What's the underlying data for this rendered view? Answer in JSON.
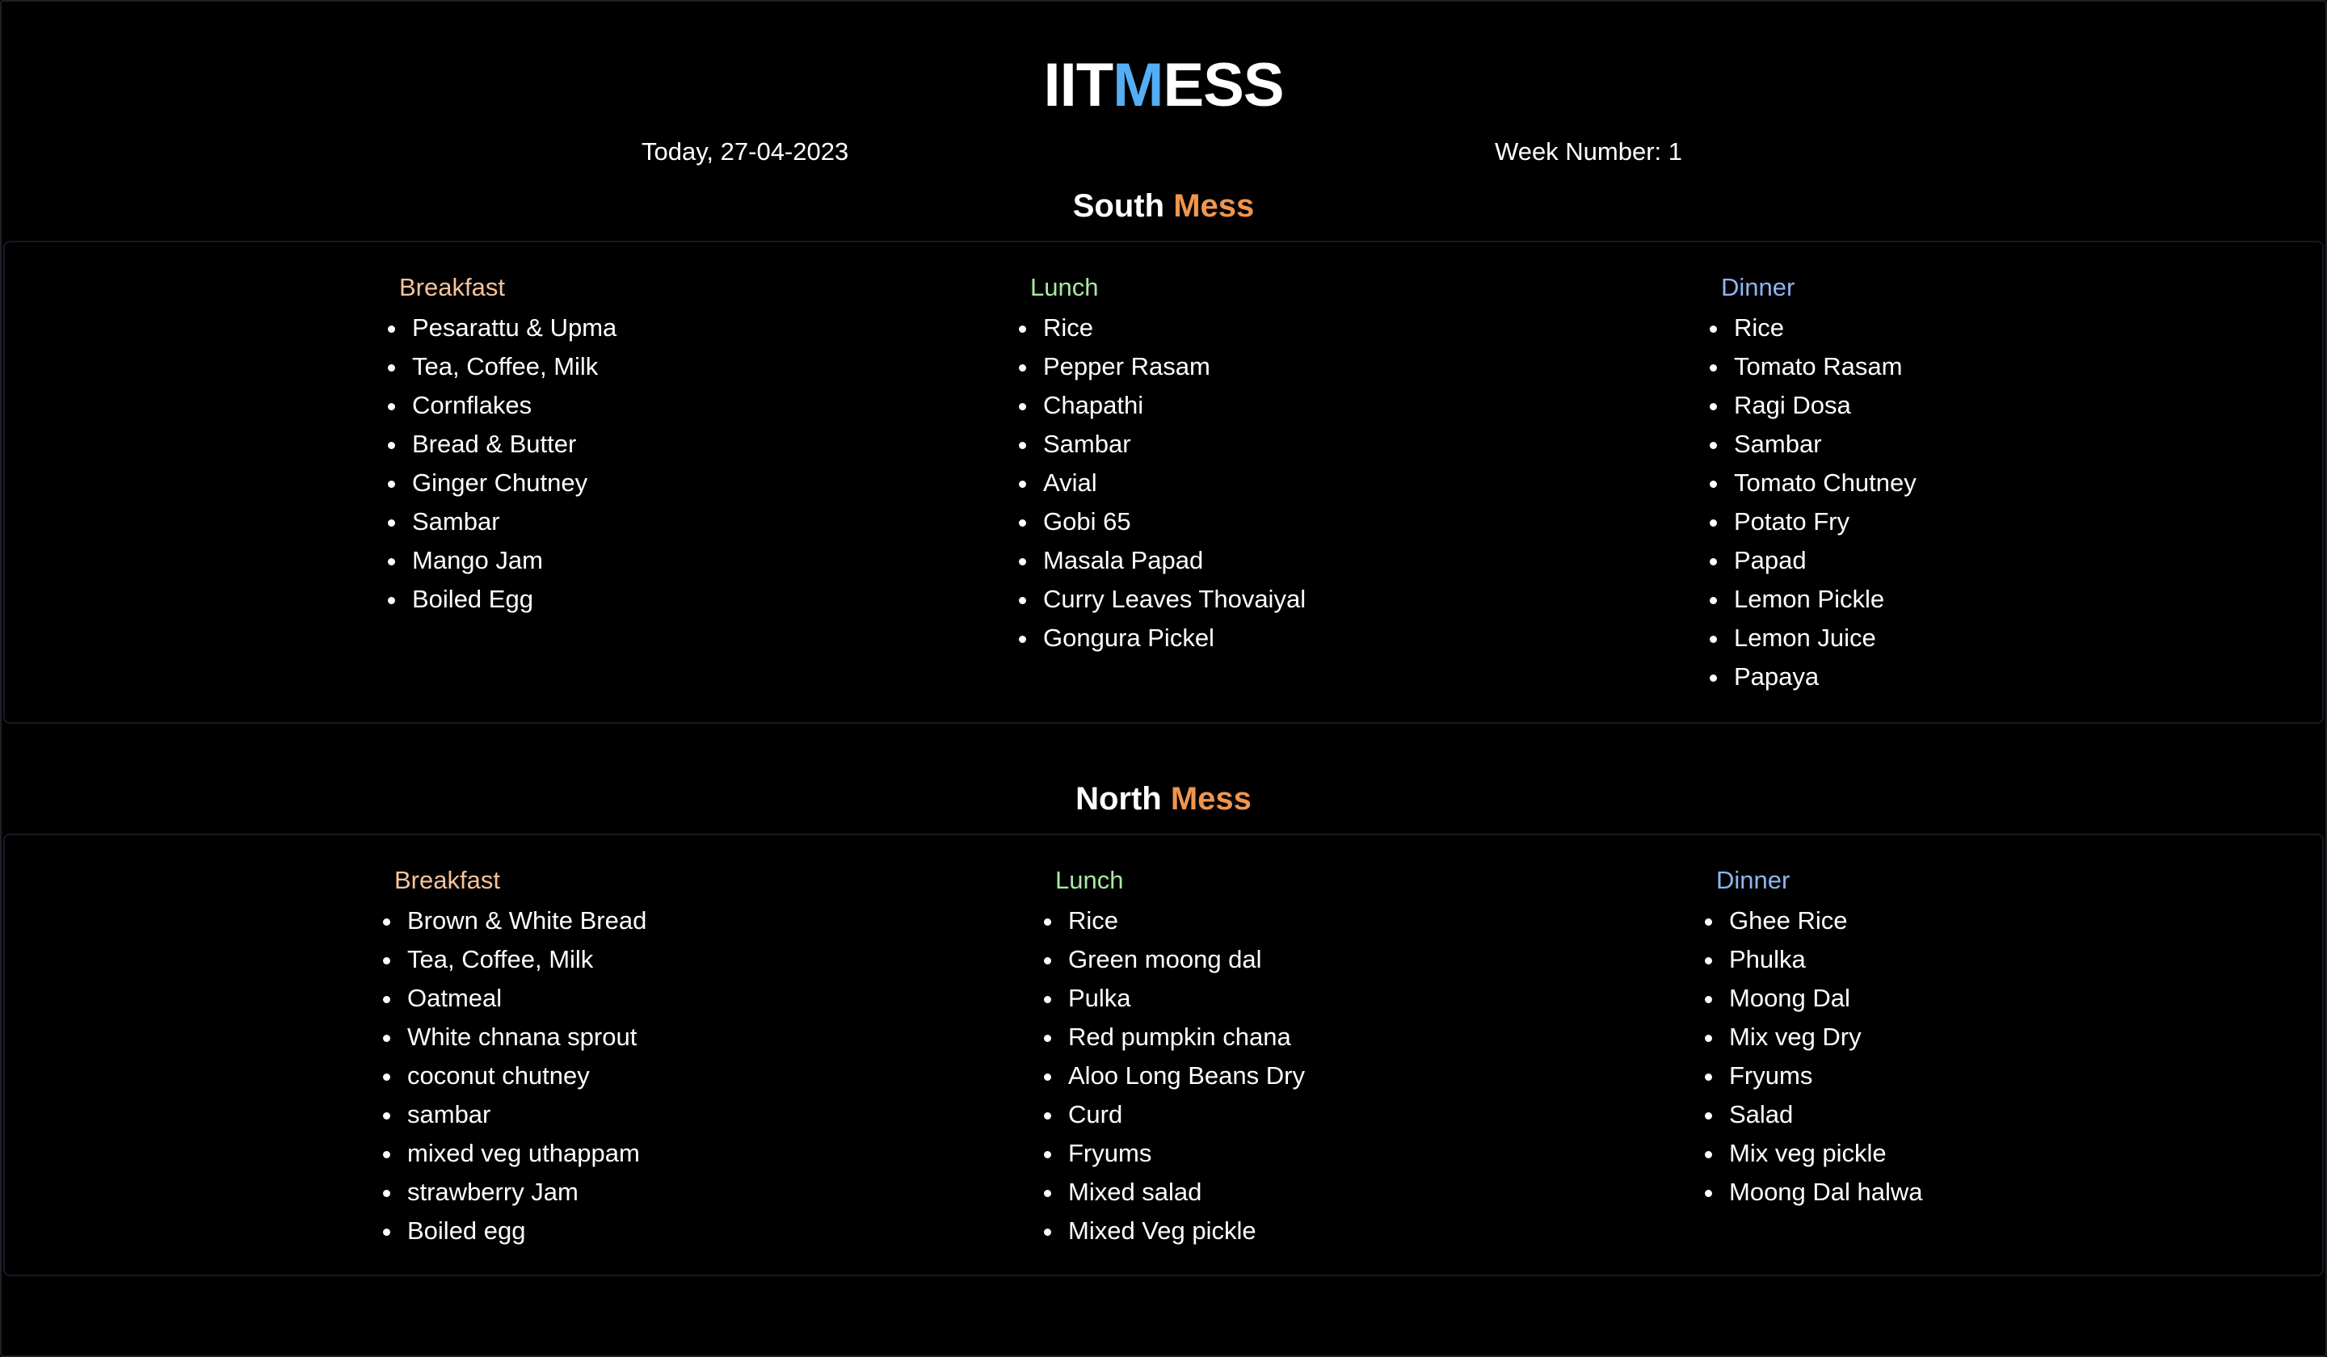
{
  "header": {
    "title_part1": "IIT",
    "title_accent": "M",
    "title_part2": "ESS",
    "today": "Today, 27-04-2023",
    "week": "Week Number: 1"
  },
  "colors": {
    "title_accent": "#54aef5",
    "mess_accent": "#f0954e",
    "breakfast": "#f6c39a",
    "lunch": "#a8e8a2",
    "dinner": "#8fb4f0"
  },
  "icons": {
    "bullet": "disc-bullet-icon"
  },
  "south": {
    "title_word": "South",
    "title_accent": "Mess",
    "breakfast": {
      "label": "Breakfast",
      "items": [
        "Pesarattu & Upma",
        "Tea, Coffee, Milk",
        "Cornflakes",
        "Bread & Butter",
        "Ginger Chutney",
        "Sambar",
        "Mango Jam",
        "Boiled Egg"
      ]
    },
    "lunch": {
      "label": "Lunch",
      "items": [
        "Rice",
        "Pepper Rasam",
        "Chapathi",
        "Sambar",
        "Avial",
        "Gobi 65",
        "Masala Papad",
        "Curry Leaves Thovaiyal",
        "Gongura Pickel"
      ]
    },
    "dinner": {
      "label": "Dinner",
      "items": [
        "Rice",
        "Tomato Rasam",
        "Ragi Dosa",
        "Sambar",
        "Tomato Chutney",
        "Potato Fry",
        "Papad",
        "Lemon Pickle",
        "Lemon Juice",
        "Papaya"
      ]
    }
  },
  "north": {
    "title_word": "North",
    "title_accent": "Mess",
    "breakfast": {
      "label": "Breakfast",
      "items": [
        "Brown & White Bread",
        "Tea, Coffee, Milk",
        "Oatmeal",
        "White chnana sprout",
        "coconut chutney",
        "sambar",
        "mixed veg uthappam",
        "strawberry Jam",
        "Boiled egg"
      ]
    },
    "lunch": {
      "label": "Lunch",
      "items": [
        "Rice",
        "Green moong dal",
        "Pulka",
        "Red pumpkin chana",
        "Aloo Long Beans Dry",
        "Curd",
        "Fryums",
        "Mixed salad",
        "Mixed Veg pickle"
      ]
    },
    "dinner": {
      "label": "Dinner",
      "items": [
        "Ghee Rice",
        "Phulka",
        "Moong Dal",
        "Mix veg Dry",
        "Fryums",
        "Salad",
        "Mix veg pickle",
        "Moong Dal halwa"
      ]
    }
  }
}
